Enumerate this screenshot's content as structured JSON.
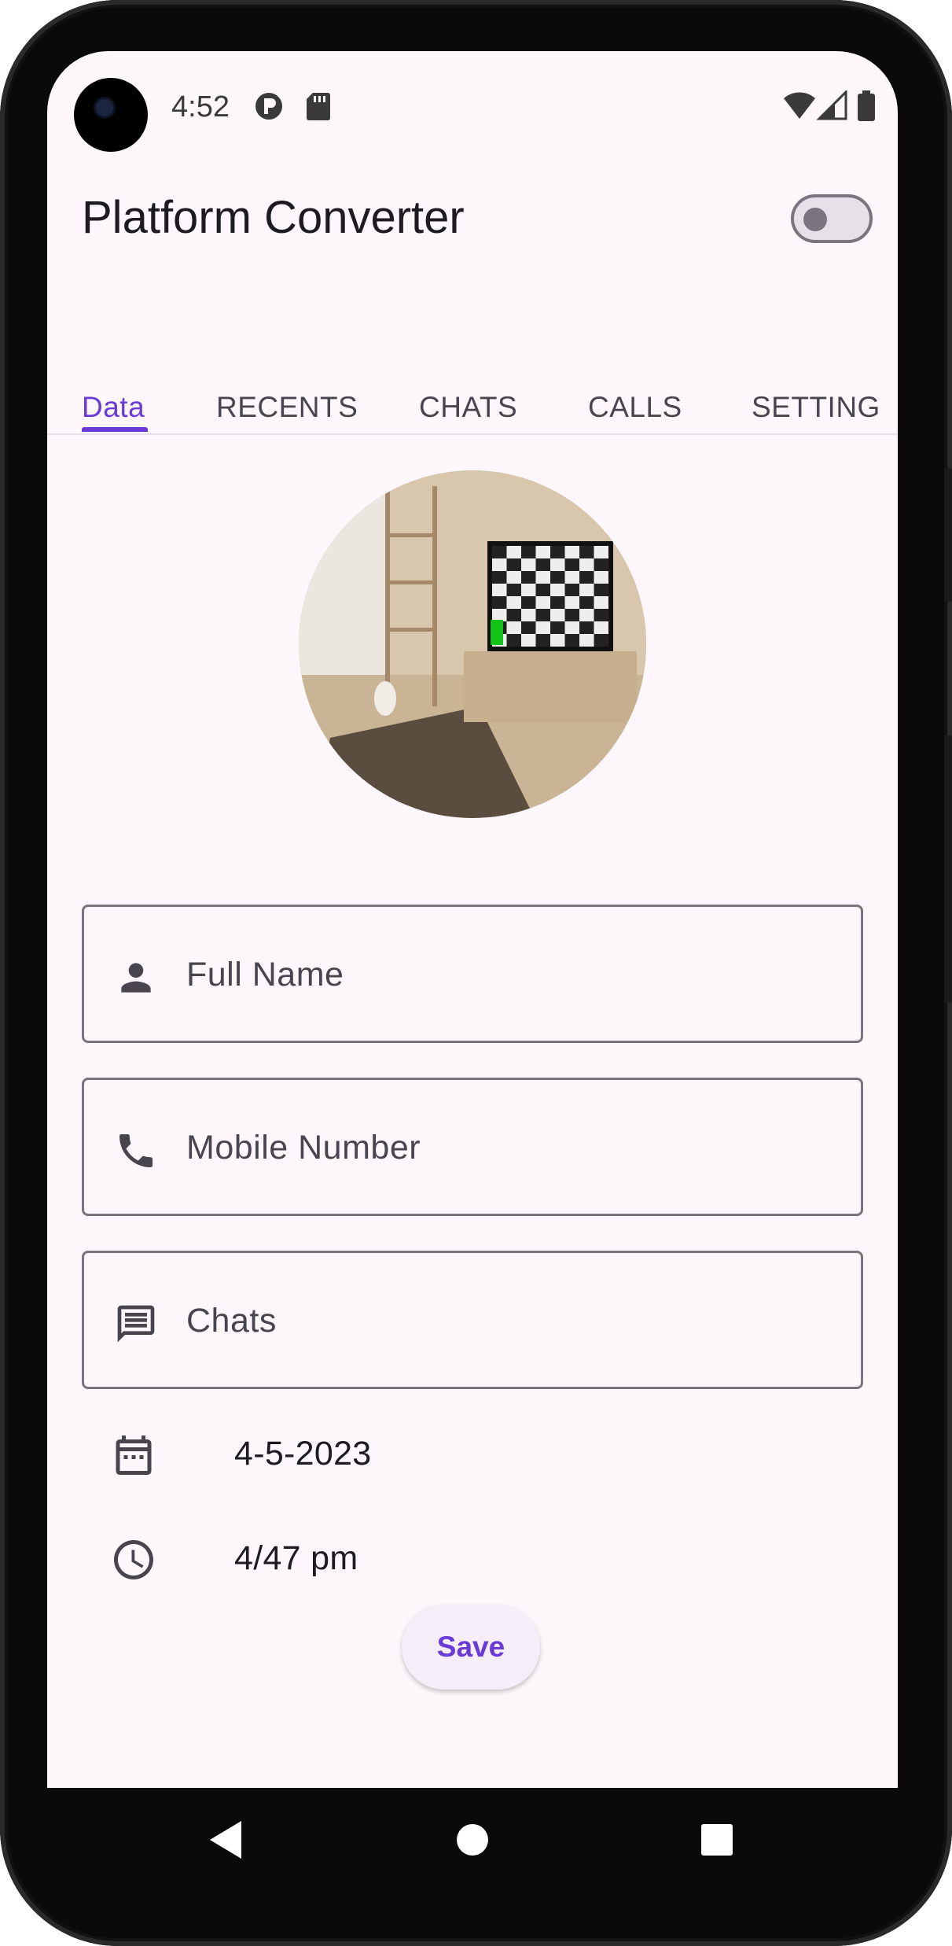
{
  "status_bar": {
    "time": "4:52",
    "icons": [
      "p-icon",
      "sd-card-icon",
      "wifi-icon",
      "signal-icon",
      "battery-icon"
    ]
  },
  "app_bar": {
    "title": "Platform Converter",
    "theme_toggle": "off"
  },
  "tabs": [
    {
      "label": "Data",
      "active": true
    },
    {
      "label": "RECENTS",
      "active": false
    },
    {
      "label": "CHATS",
      "active": false
    },
    {
      "label": "CALLS",
      "active": false
    },
    {
      "label": "SETTING",
      "active": false
    }
  ],
  "form": {
    "full_name": {
      "placeholder": "Full Name",
      "icon": "person-icon"
    },
    "mobile": {
      "placeholder": "Mobile Number",
      "icon": "phone-icon"
    },
    "chats": {
      "placeholder": "Chats",
      "icon": "message-icon"
    },
    "date": {
      "value": "4-5-2023",
      "icon": "calendar-icon"
    },
    "time": {
      "value": "4/47 pm",
      "icon": "clock-icon"
    },
    "save_label": "Save"
  },
  "colors": {
    "accent": "#6a3ad6",
    "surface": "#fdf7fb",
    "outline": "#79747e"
  },
  "nav_bar": [
    "back-icon",
    "home-icon",
    "recents-icon"
  ]
}
